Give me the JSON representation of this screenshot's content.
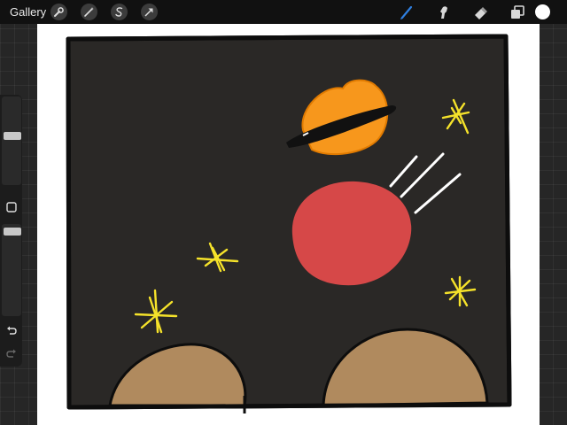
{
  "topbar": {
    "gallery_label": "Gallery",
    "left_tools": [
      "wrench-icon",
      "magic-wand-icon",
      "selection-icon",
      "move-arrow-icon"
    ],
    "right_tools": [
      "brush-icon",
      "smudge-icon",
      "eraser-icon",
      "layers-icon"
    ],
    "active_tool": "brush-icon",
    "accent_color": "#2f7fe0",
    "current_color": "#ffffff"
  },
  "sidebar": {
    "brush_size_level": 0.2,
    "opacity_level": 0.2,
    "buttons": [
      "modify-square-icon",
      "undo-icon",
      "redo-icon"
    ]
  },
  "artwork": {
    "background_color": "#2a2826",
    "planet_color": "#f7971c",
    "ball_color": "#d64848",
    "star_color": "#f5e22a",
    "hill_color": "#b08a5e"
  }
}
